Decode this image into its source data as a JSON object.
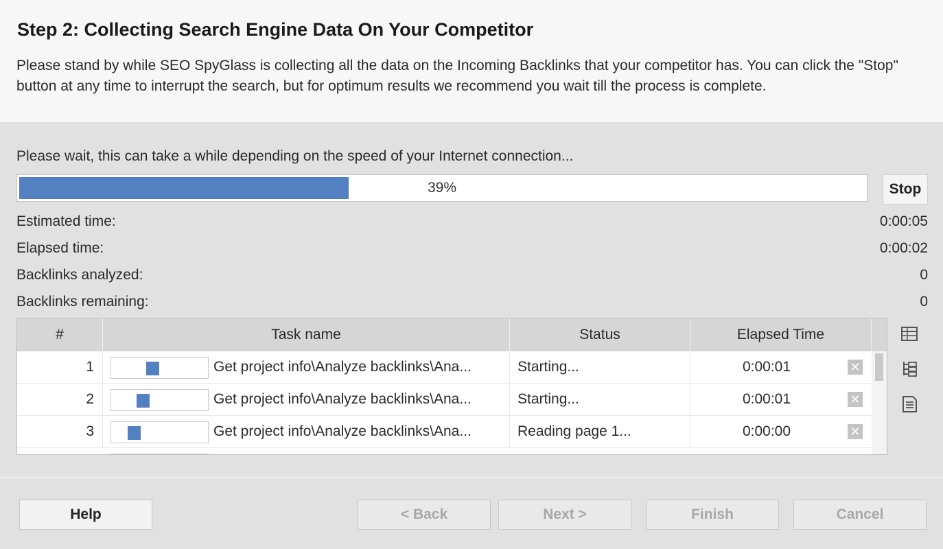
{
  "header": {
    "title": "Step 2: Collecting Search Engine Data On Your Competitor",
    "description": "Please stand by while SEO SpyGlass is collecting all the data on the Incoming Backlinks that your competitor has. You can click the \"Stop\" button at any time to interrupt the search, but for optimum results we recommend you wait till the process is complete."
  },
  "progress": {
    "message": "Please wait, this can take a while depending on the speed of your Internet connection...",
    "percent_label": "39%",
    "percent": 39,
    "stop_label": "Stop"
  },
  "stats": [
    {
      "label": "Estimated time:",
      "value": "0:00:05"
    },
    {
      "label": "Elapsed time:",
      "value": "0:00:02"
    },
    {
      "label": "Backlinks analyzed:",
      "value": "0"
    },
    {
      "label": "Backlinks remaining:",
      "value": "0"
    }
  ],
  "table": {
    "columns": [
      "#",
      "Task name",
      "Status",
      "Elapsed Time"
    ],
    "rows": [
      {
        "num": "1",
        "task": "Get project info\\Analyze backlinks\\Ana...",
        "status": "Starting...",
        "elapsed": "0:00:01",
        "activity": 0.42
      },
      {
        "num": "2",
        "task": "Get project info\\Analyze backlinks\\Ana...",
        "status": "Starting...",
        "elapsed": "0:00:01",
        "activity": 0.3
      },
      {
        "num": "3",
        "task": "Get project info\\Analyze backlinks\\Ana...",
        "status": "Reading page 1...",
        "elapsed": "0:00:00",
        "activity": 0.2
      }
    ]
  },
  "side_icons": [
    "table-icon",
    "tree-icon",
    "document-icon"
  ],
  "footer": {
    "help": "Help",
    "back": "< Back",
    "next": "Next >",
    "finish": "Finish",
    "cancel": "Cancel"
  },
  "colors": {
    "accent": "#5380c0"
  }
}
